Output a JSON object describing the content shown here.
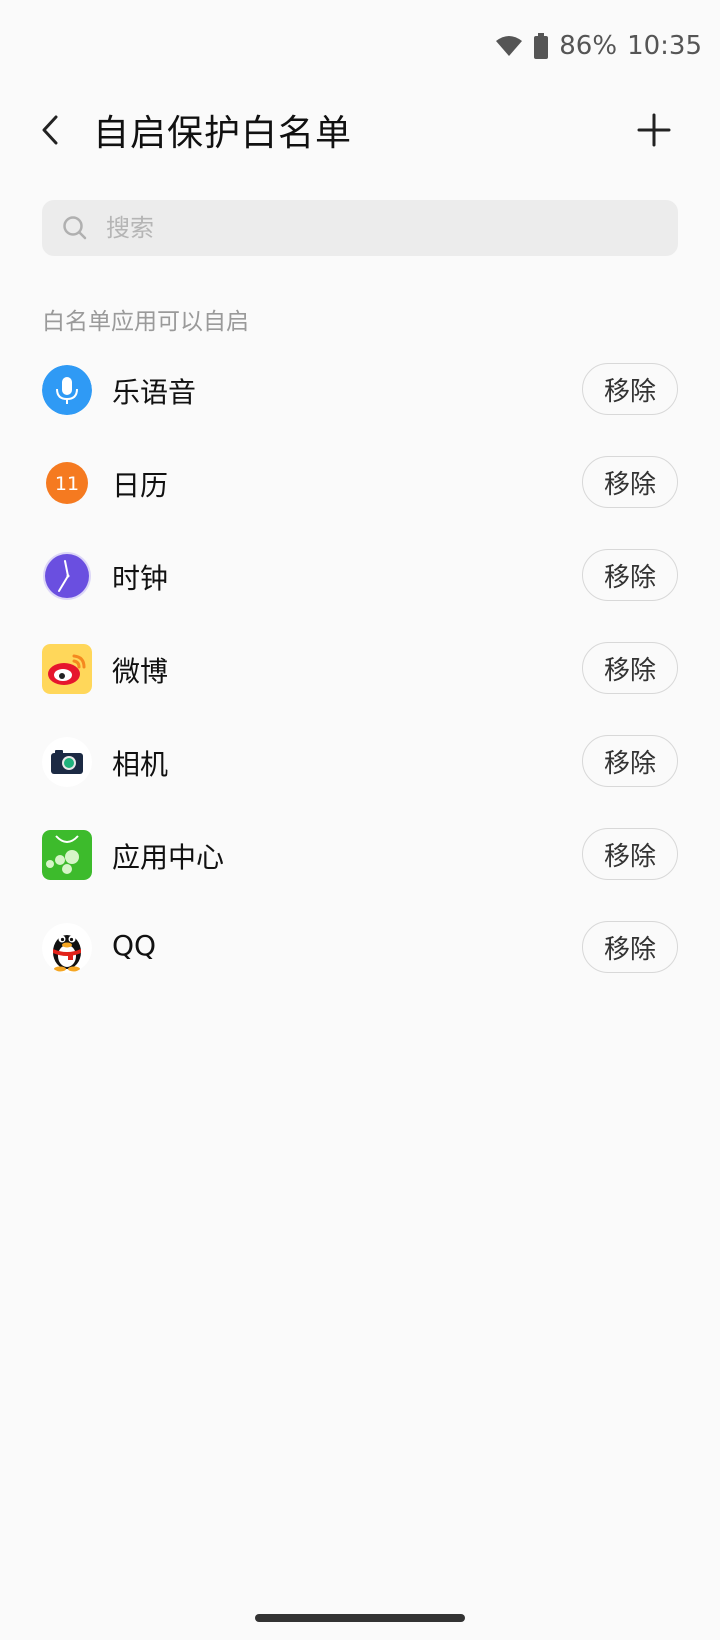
{
  "status_bar": {
    "battery": "86%",
    "time": "10:35"
  },
  "header": {
    "title": "自启保护白名单"
  },
  "search": {
    "placeholder": "搜索"
  },
  "section": {
    "label": "白名单应用可以自启"
  },
  "apps": [
    {
      "name": "乐语音",
      "icon": "microphone-icon",
      "remove_label": "移除"
    },
    {
      "name": "日历",
      "icon": "calendar-icon",
      "icon_text": "11",
      "remove_label": "移除"
    },
    {
      "name": "时钟",
      "icon": "clock-icon",
      "remove_label": "移除"
    },
    {
      "name": "微博",
      "icon": "weibo-icon",
      "remove_label": "移除"
    },
    {
      "name": "相机",
      "icon": "camera-icon",
      "remove_label": "移除"
    },
    {
      "name": "应用中心",
      "icon": "app-center-icon",
      "remove_label": "移除"
    },
    {
      "name": "QQ",
      "icon": "qq-penguin-icon",
      "remove_label": "移除"
    }
  ],
  "colors": {
    "background": "#fafafa",
    "voice": "#2f9af5",
    "calendar": "#f57a20",
    "clock": "#6a4fe0",
    "weibo_bg": "#ffd75a",
    "app_center": "#3dbb2c"
  }
}
